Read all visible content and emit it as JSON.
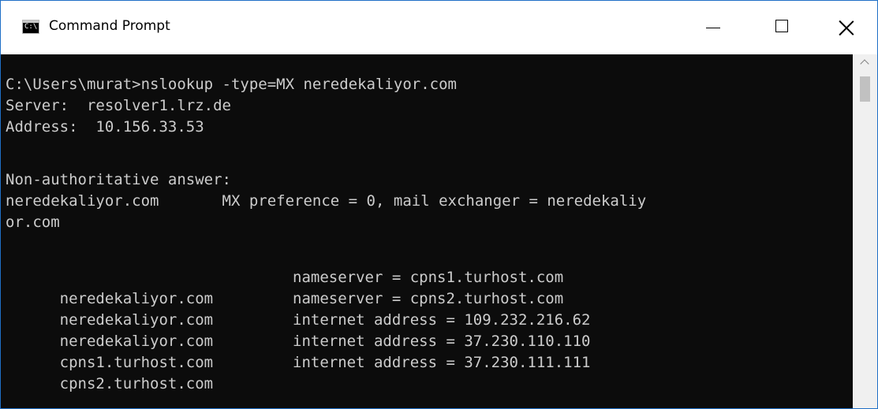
{
  "window": {
    "title": "Command Prompt",
    "icon": "cmd-icon",
    "icon_glyph": "C:\\.",
    "controls": [
      "minimize-icon",
      "maximize-icon",
      "close-icon"
    ]
  },
  "console": {
    "prompt": "C:\\Users\\murat>nslookup -type=MX neredekaliyor.com",
    "server": "Server:  resolver1.lrz.de",
    "address": "Address:  10.156.33.53",
    "non_auth": "Non-authoritative answer:",
    "mx_line": "neredekaliyor.com       MX preference = 0, mail exchanger = neredekaliy",
    "mx_wrap": "or.com",
    "records": [
      {
        "host": "neredekaliyor.com",
        "value": "nameserver = cpns1.turhost.com"
      },
      {
        "host": "neredekaliyor.com",
        "value": "nameserver = cpns2.turhost.com"
      },
      {
        "host": "neredekaliyor.com",
        "value": "internet address = 109.232.216.62"
      },
      {
        "host": "cpns1.turhost.com",
        "value": "internet address = 37.230.110.110"
      },
      {
        "host": "cpns2.turhost.com",
        "value": "internet address = 37.230.111.111"
      }
    ]
  },
  "colors": {
    "console_bg": "#0c0c0c",
    "console_text": "#cccccc",
    "window_border": "#1f6fc6"
  }
}
